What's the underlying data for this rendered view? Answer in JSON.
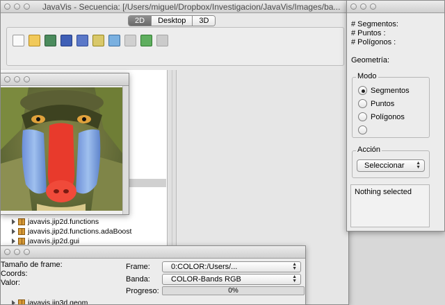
{
  "main": {
    "title": "JavaVis - Secuencia: [/Users/miguel/Dropbox/Investigacion/JavaVis/Images/ba...",
    "tabs": [
      "2D",
      "Desktop",
      "3D"
    ],
    "active_tab": "2D",
    "toolbar_icons": [
      "new-document-icon",
      "open-folder-icon",
      "globe-icon",
      "save-icon",
      "save-as-icon",
      "image-icon",
      "chart-icon",
      "disabled-tool-icon",
      "cube-icon",
      "disabled-pen-icon"
    ],
    "tree": [
      {
        "label": "javavis.jip2d.functions"
      },
      {
        "label": "javavis.jip2d.functions.adaBoost"
      },
      {
        "label": "javavis.jip2d.gui"
      },
      {
        "label": "javavis.jip3d.geom"
      }
    ]
  },
  "props": {
    "segmentos_label": "# Segmentos:",
    "puntos_label": "# Puntos :",
    "poligonos_label": "# Polígonos :",
    "geometria_label": "Geometría:",
    "modo_title": "Modo",
    "modo_options": [
      "Segmentos",
      "Puntos",
      "Polígonos",
      ""
    ],
    "modo_selected": "Segmentos",
    "accion_title": "Acción",
    "accion_value": "Seleccionar",
    "status": "Nothing selected"
  },
  "frame": {
    "tamano_label": "Tamaño de frame:",
    "coords_label": "Coords:",
    "valor_label": "Valor:",
    "frame_label": "Frame:",
    "frame_value": "0:COLOR:/Users/...",
    "banda_label": "Banda:",
    "banda_value": "COLOR-Bands RGB",
    "progreso_label": "Progreso:",
    "progress_value": 0,
    "progress_text": "0%"
  },
  "colors": {
    "accent": "#7fa6d6",
    "tab_active": "#7a7a7a"
  }
}
